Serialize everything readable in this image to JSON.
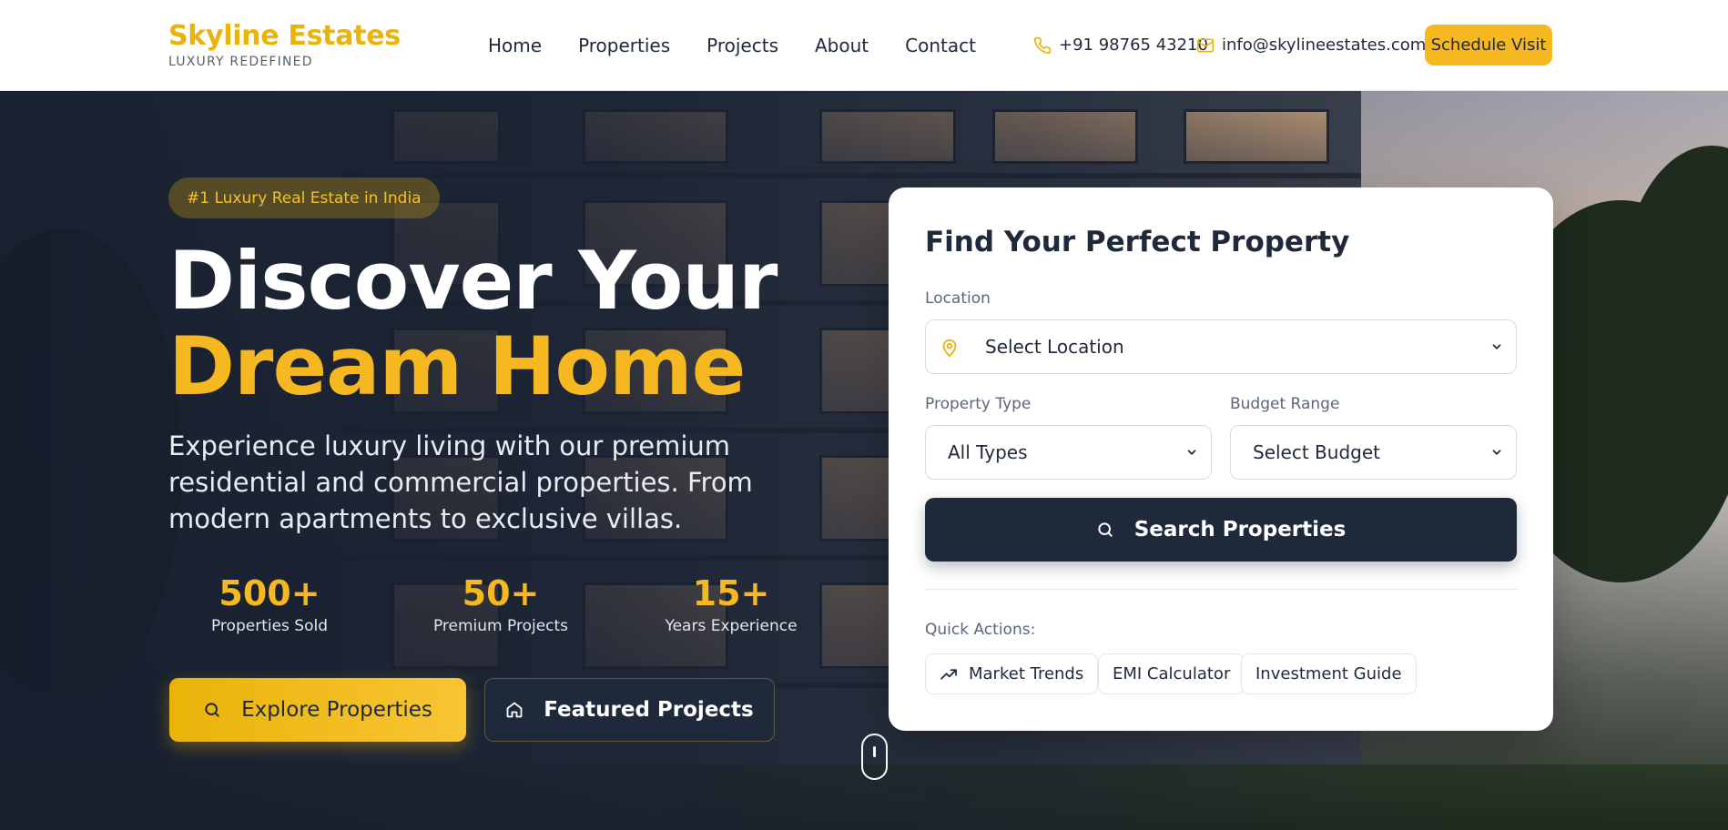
{
  "header": {
    "brand_name": "Skyline Estates",
    "brand_tagline": "LUXURY REDEFINED",
    "nav": [
      "Home",
      "Properties",
      "Projects",
      "About",
      "Contact"
    ],
    "phone": "+91 98765 43210",
    "email": "info@skylineestates.com",
    "cta_label": "Schedule Visit"
  },
  "hero": {
    "badge": "#1 Luxury Real Estate in India",
    "title_line1": "Discover Your",
    "title_line2": "Dream Home",
    "subtitle": "Experience luxury living with our premium residential and commercial properties. From modern apartments to exclusive villas.",
    "stats": [
      {
        "value": "500+",
        "label": "Properties Sold"
      },
      {
        "value": "50+",
        "label": "Premium Projects"
      },
      {
        "value": "15+",
        "label": "Years Experience"
      }
    ],
    "primary_button": "Explore Properties",
    "secondary_button": "Featured Projects"
  },
  "search": {
    "title": "Find Your Perfect Property",
    "location_label": "Location",
    "location_value": "Select Location",
    "type_label": "Property Type",
    "type_value": "All Types",
    "budget_label": "Budget Range",
    "budget_value": "Select Budget",
    "button": "Search Properties",
    "quick_actions_label": "Quick Actions:",
    "quick_actions": [
      "Market Trends",
      "EMI Calculator",
      "Investment Guide"
    ]
  },
  "icons": {
    "phone": "phone-icon",
    "email": "mail-icon",
    "search": "search-icon",
    "home": "home-icon",
    "location": "map-pin-icon",
    "trend": "trending-up-icon",
    "chevron": "chevron-down-icon",
    "scroll": "mouse-scroll-icon"
  },
  "colors": {
    "accent": "#f5b820",
    "navy": "#1e293b",
    "white": "#ffffff"
  }
}
